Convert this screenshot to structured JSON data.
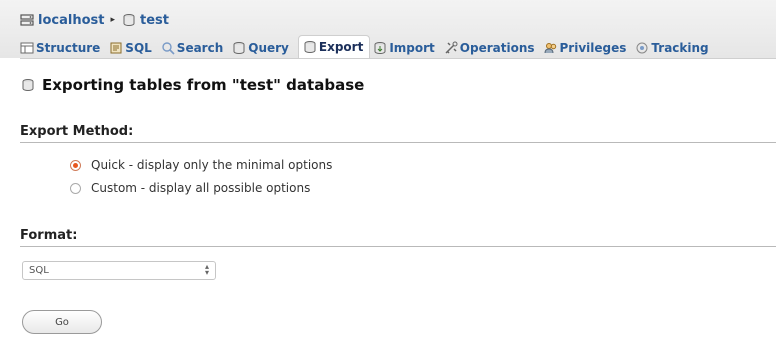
{
  "breadcrumb": {
    "server": "localhost",
    "separator": "▸",
    "database": "test"
  },
  "tabs": [
    {
      "label": "Structure",
      "icon": "structure-icon"
    },
    {
      "label": "SQL",
      "icon": "sql-icon"
    },
    {
      "label": "Search",
      "icon": "search-icon"
    },
    {
      "label": "Query",
      "icon": "query-icon"
    },
    {
      "label": "Export",
      "icon": "export-icon",
      "active": true
    },
    {
      "label": "Import",
      "icon": "import-icon"
    },
    {
      "label": "Operations",
      "icon": "operations-icon"
    },
    {
      "label": "Privileges",
      "icon": "privileges-icon"
    },
    {
      "label": "Tracking",
      "icon": "tracking-icon"
    }
  ],
  "page": {
    "title": "Exporting tables from \"test\" database"
  },
  "export_method": {
    "heading": "Export Method:",
    "options": [
      {
        "label": "Quick - display only the minimal options",
        "checked": true
      },
      {
        "label": "Custom - display all possible options",
        "checked": false
      }
    ]
  },
  "format": {
    "heading": "Format:",
    "selected": "SQL"
  },
  "actions": {
    "go_label": "Go"
  },
  "colors": {
    "link": "#2a5d9a",
    "radio_selected": "#e8561e"
  }
}
